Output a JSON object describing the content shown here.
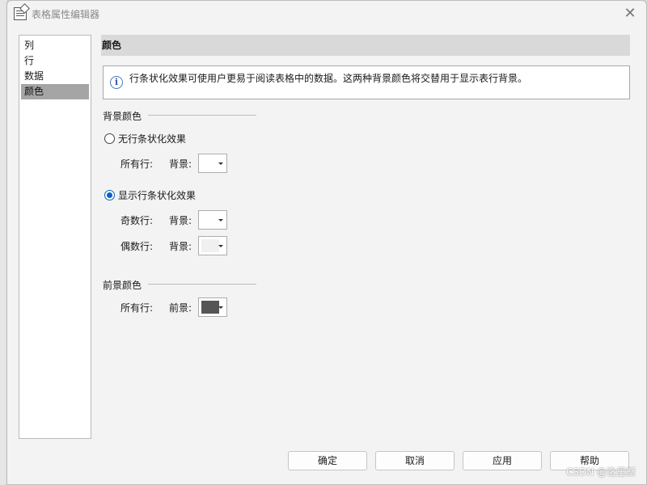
{
  "window": {
    "title": "表格属性编辑器",
    "close_glyph": "✕"
  },
  "nav": {
    "items": [
      {
        "label": "列"
      },
      {
        "label": "行"
      },
      {
        "label": "数据"
      },
      {
        "label": "颜色"
      }
    ],
    "selected": "颜色"
  },
  "panel": {
    "header": "颜色",
    "info_text": "行条状化效果可使用户更易于阅读表格中的数据。这两种背景颜色将交替用于显示表行背景。",
    "background_group": {
      "label": "背景颜色",
      "option_none": {
        "label": "无行条状化效果",
        "checked": false
      },
      "all_rows_label": "所有行:",
      "bg_label": "背景:",
      "option_striped": {
        "label": "显示行条状化效果",
        "checked": true
      },
      "odd_rows_label": "奇数行:",
      "even_rows_label": "偶数行:"
    },
    "foreground_group": {
      "label": "前景颜色",
      "all_rows_label": "所有行:",
      "fg_label": "前景:"
    }
  },
  "colors": {
    "all_rows_bg": "#ffffff",
    "odd_rows_bg": "#ffffff",
    "even_rows_bg": "#f0f0f0",
    "all_rows_fg": "#555555",
    "accent": "#0a62c2"
  },
  "buttons": {
    "ok": "确定",
    "cancel": "取消",
    "apply": "应用",
    "help": "帮助"
  },
  "watermark": "CSDN @洛里斯"
}
